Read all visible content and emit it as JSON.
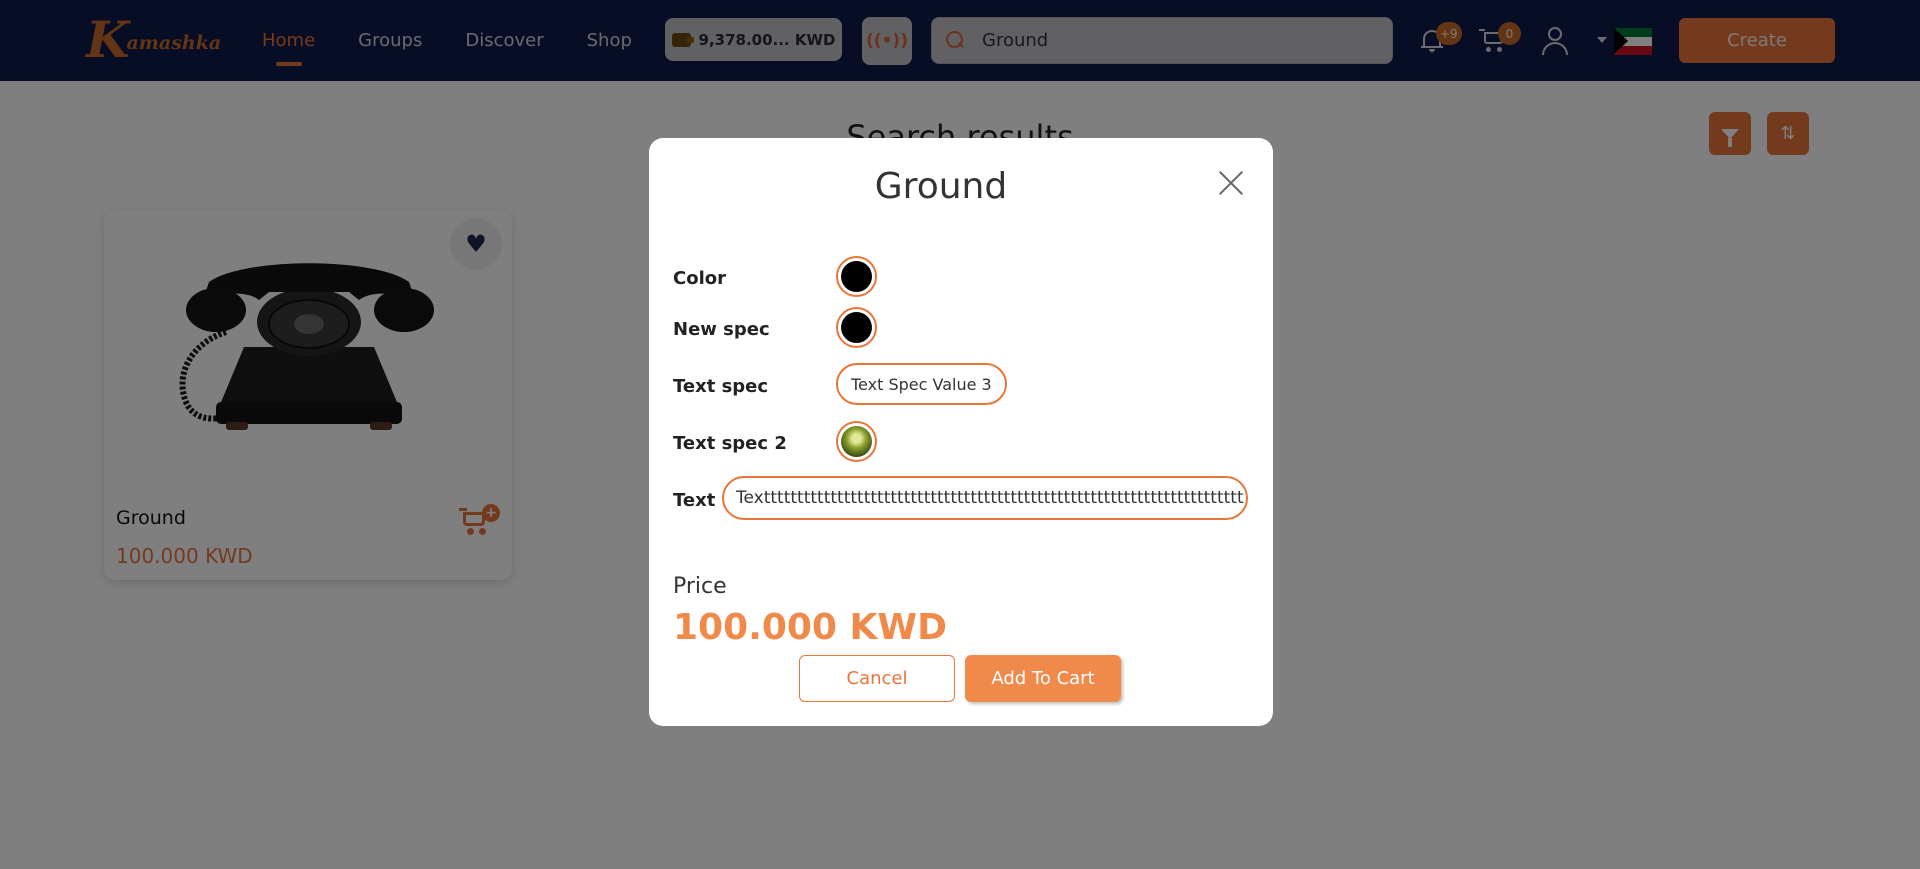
{
  "brand": {
    "logo_initial": "K",
    "logo_rest": "amashka"
  },
  "nav": {
    "items": [
      "Home",
      "Groups",
      "Discover",
      "Shop"
    ],
    "active_index": 0
  },
  "wallet": {
    "balance": "9,378.00... KWD",
    "icon": "coins-icon"
  },
  "live": {
    "icon": "broadcast-icon"
  },
  "search": {
    "value": "Ground",
    "icon": "search-icon"
  },
  "notifications": {
    "count": "+9"
  },
  "cart": {
    "count": "0"
  },
  "language": {
    "flag": "kuwait-flag"
  },
  "header": {
    "create_label": "Create"
  },
  "page": {
    "title": "Search results"
  },
  "product_card": {
    "name": "Ground",
    "price": "100.000 KWD",
    "image": "rotary-telephone",
    "favorited": true
  },
  "modal": {
    "title": "Ground",
    "specs": {
      "color_label": "Color",
      "color_value": "#000000",
      "new_spec_label": "New spec",
      "new_spec_value": "#000000",
      "text_spec_label": "Text spec",
      "text_spec_value": "Text Spec Value 3",
      "text_spec2_label": "Text spec 2",
      "text_spec2_value": "image-swatch",
      "text_label": "Text",
      "text_value": "Textttttttttttttttttttttttttttttttttttttttttttttttttttttttttttttttttttttttt"
    },
    "price_label": "Price",
    "price_value": "100.000 KWD",
    "cancel_label": "Cancel",
    "add_label": "Add To Cart"
  },
  "colors": {
    "navy": "#0f1a4a",
    "accent": "#e9753a",
    "price": "#f08a4b"
  }
}
